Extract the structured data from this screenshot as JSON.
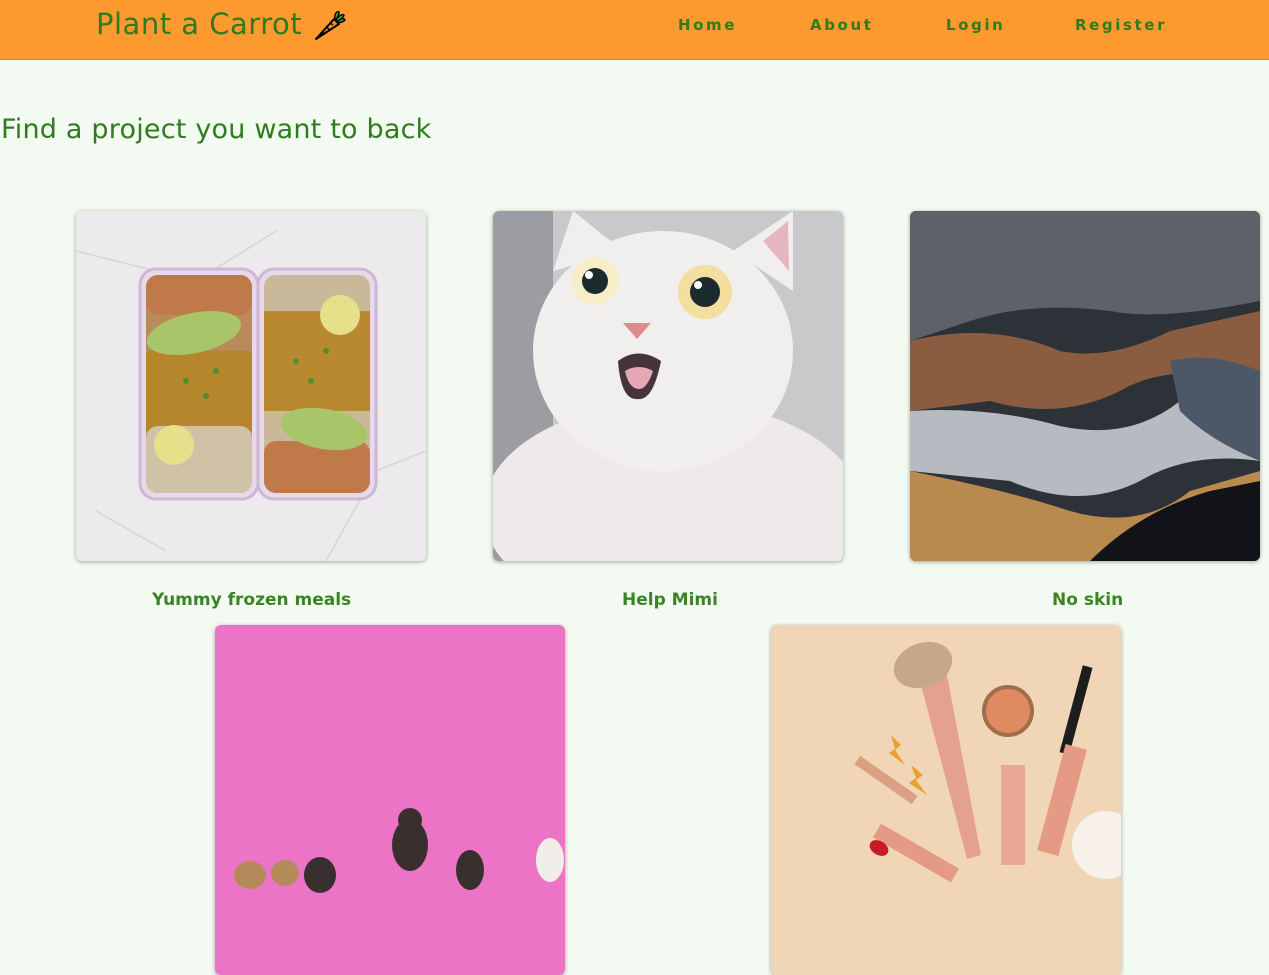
{
  "brand": {
    "name": "Plant a Carrot",
    "icon": "carrot-icon"
  },
  "nav": {
    "home": "Home",
    "about": "About",
    "login": "Login",
    "register": "Register"
  },
  "page": {
    "heading": "Find a project you want to back"
  },
  "projects": [
    {
      "title": "Yummy frozen meals",
      "image": "meal-prep-boxes"
    },
    {
      "title": "Help Mimi",
      "image": "white-cat"
    },
    {
      "title": "No skin",
      "image": "leather-swatches"
    },
    {
      "title": "",
      "image": "dogs-on-pink"
    },
    {
      "title": "",
      "image": "makeup-brushes"
    }
  ],
  "colors": {
    "navbar": "#fd9a2f",
    "background": "#f3faf1",
    "text_green": "#2f7c1e"
  }
}
